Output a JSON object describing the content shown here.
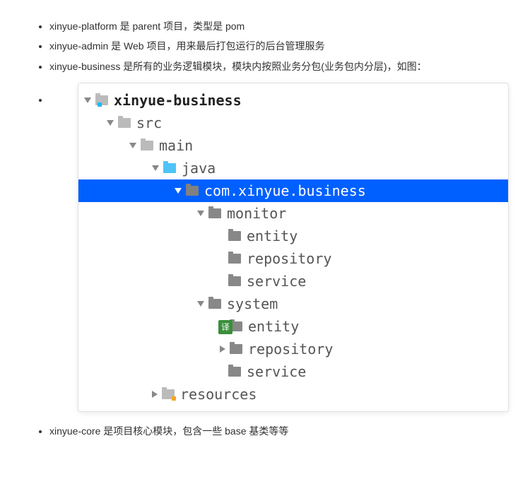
{
  "bullets_top": [
    "xinyue-platform 是 parent 项目，类型是 pom",
    "xinyue-admin 是 Web 项目，用来最后打包运行的后台管理服务",
    "xinyue-business 是所有的业务逻辑模块，模块内按照业务分包(业务包内分层)，如图："
  ],
  "bullets_bottom": [
    "xinyue-core 是项目核心模块，包含一些 base 基类等等"
  ],
  "tree": [
    {
      "depth": 0,
      "arrow": "down",
      "icon": "folder-blue-dot",
      "label": "xinyue-business",
      "root": true
    },
    {
      "depth": 1,
      "arrow": "down",
      "icon": "folder",
      "label": "src"
    },
    {
      "depth": 2,
      "arrow": "down",
      "icon": "folder",
      "label": "main"
    },
    {
      "depth": 3,
      "arrow": "down",
      "icon": "folder-blue",
      "label": "java"
    },
    {
      "depth": 4,
      "arrow": "down",
      "icon": "folder-dark",
      "label": "com.xinyue.business",
      "selected": true
    },
    {
      "depth": 5,
      "arrow": "down",
      "icon": "folder-dark",
      "label": "monitor"
    },
    {
      "depth": 6,
      "arrow": "none",
      "icon": "folder-dark",
      "label": "entity"
    },
    {
      "depth": 6,
      "arrow": "none",
      "icon": "folder-dark",
      "label": "repository"
    },
    {
      "depth": 6,
      "arrow": "none",
      "icon": "folder-dark",
      "label": "service"
    },
    {
      "depth": 5,
      "arrow": "down",
      "icon": "folder-dark",
      "label": "system"
    },
    {
      "depth": 6,
      "arrow": "right",
      "icon": "folder-dark",
      "label": "entity"
    },
    {
      "depth": 6,
      "arrow": "right",
      "icon": "folder-dark",
      "label": "repository"
    },
    {
      "depth": 6,
      "arrow": "none",
      "icon": "folder-dark",
      "label": "service"
    },
    {
      "depth": 3,
      "arrow": "right",
      "icon": "folder-orange-dot",
      "label": "resources"
    }
  ],
  "translate_badge": "译"
}
